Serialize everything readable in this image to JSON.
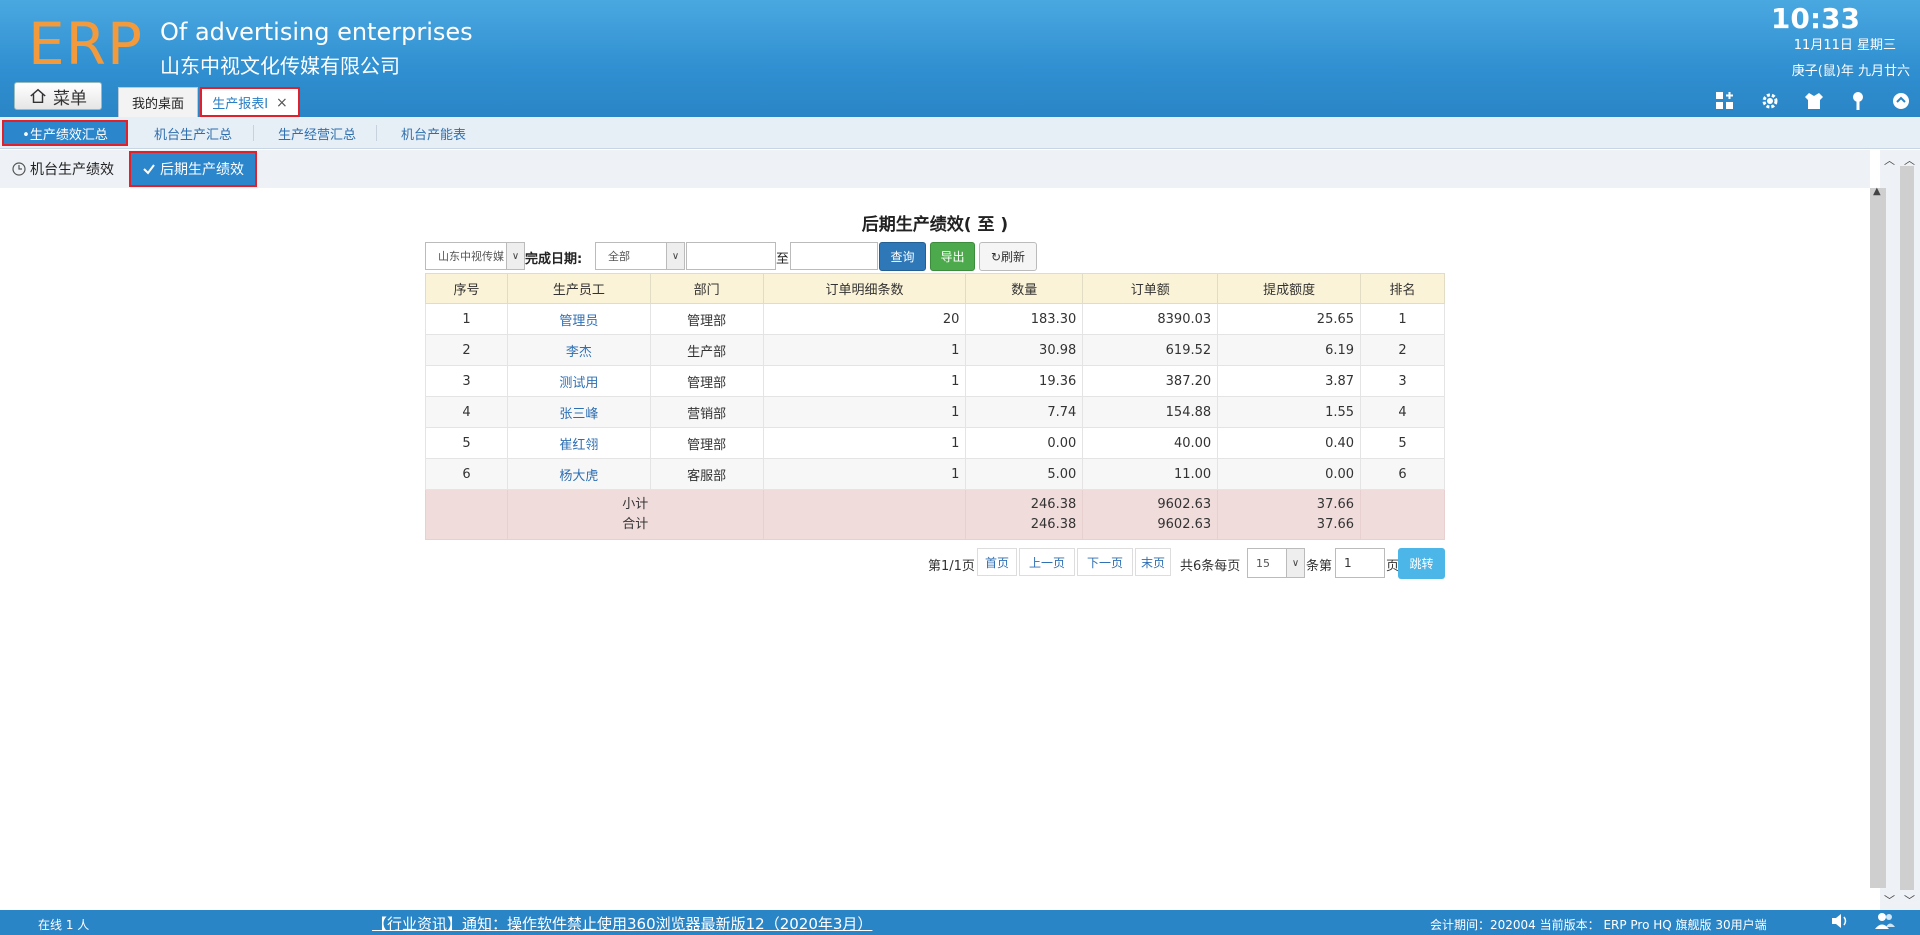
{
  "header": {
    "logo": "ERP",
    "company_en": "Of advertising enterprises",
    "company_cn": "山东中视文化传媒有限公司",
    "time": "10:33",
    "date": "11月11日 星期三",
    "lunar": "庚子(鼠)年 九月廿六",
    "menu_label": "菜单",
    "tabs": [
      {
        "label": "我的桌面"
      },
      {
        "label": "生产报表Ⅰ",
        "close": "×"
      }
    ]
  },
  "subnav": {
    "items": [
      "•生产绩效汇总",
      "机台生产汇总",
      "生产经营汇总",
      "机台产能表"
    ]
  },
  "subtabs": {
    "items": [
      "机台生产绩效",
      "后期生产绩效"
    ]
  },
  "report": {
    "title": "后期生产绩效( 至 )",
    "company_select": "山东中视传媒",
    "date_label": "完成日期:",
    "date_select": "全部",
    "to_label": "至",
    "query_btn": "查询",
    "export_btn": "导出",
    "refresh_btn": "刷新"
  },
  "table": {
    "headers": [
      "序号",
      "生产员工",
      "部门",
      "订单明细条数",
      "数量",
      "订单额",
      "提成额度",
      "排名"
    ],
    "rows": [
      [
        "1",
        "管理员",
        "管理部",
        "20",
        "183.30",
        "8390.03",
        "25.65",
        "1"
      ],
      [
        "2",
        "李杰",
        "生产部",
        "1",
        "30.98",
        "619.52",
        "6.19",
        "2"
      ],
      [
        "3",
        "测试用",
        "管理部",
        "1",
        "19.36",
        "387.20",
        "3.87",
        "3"
      ],
      [
        "4",
        "张三峰",
        "营销部",
        "1",
        "7.74",
        "154.88",
        "1.55",
        "4"
      ],
      [
        "5",
        "崔红翎",
        "管理部",
        "1",
        "0.00",
        "40.00",
        "0.40",
        "5"
      ],
      [
        "6",
        "杨大虎",
        "客服部",
        "1",
        "5.00",
        "11.00",
        "0.00",
        "6"
      ]
    ],
    "subtotal_label": "小计",
    "total_label": "合计",
    "subtotal": {
      "qty": "246.38",
      "amount": "9602.63",
      "commission": "37.66"
    },
    "total": {
      "qty": "246.38",
      "amount": "9602.63",
      "commission": "37.66"
    }
  },
  "pager": {
    "page_info": "第1/1页",
    "first": "首页",
    "prev": "上一页",
    "next": "下一页",
    "last": "末页",
    "count_text": "共6条每页",
    "page_size": "15",
    "unit": "条第",
    "page_no": "1",
    "page_unit": "页",
    "go": "跳转"
  },
  "footer": {
    "online": "在线   1   人",
    "notice": "【行业资讯】通知：操作软件禁止使用360浏览器最新版12（2020年3月）",
    "version": "会计期间：202004 当前版本： ERP Pro HQ 旗舰版 30用户端"
  },
  "colors": {
    "header_blue": "#2f8fd0",
    "logo_orange": "#f39a3c",
    "highlight_red": "#e0202a",
    "table_header": "#fbf3d7",
    "total_row": "#f1dcdc"
  }
}
